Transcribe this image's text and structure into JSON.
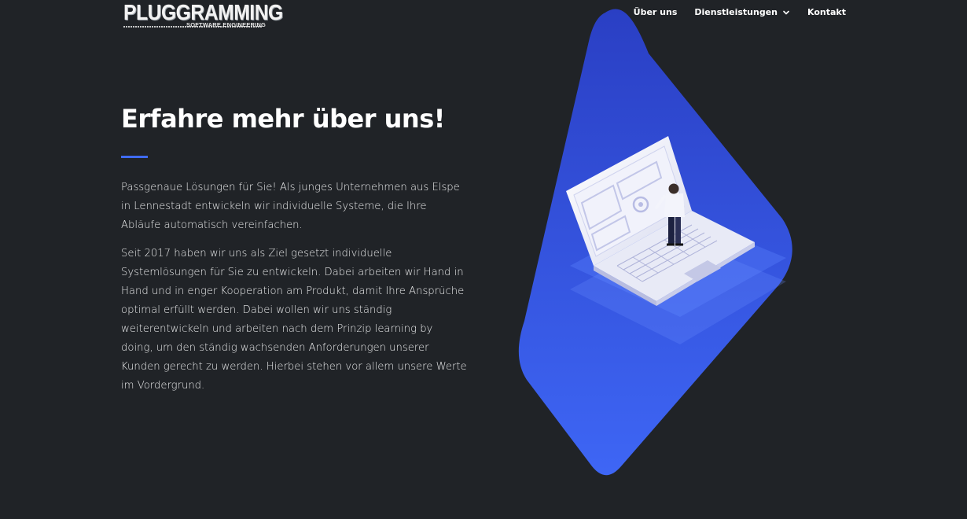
{
  "header": {
    "logo": {
      "main": "PLUGGRAMMING",
      "sub": "SOFTWARE ENGINEERING"
    },
    "nav": [
      {
        "label": "Über uns"
      },
      {
        "label": "Dienstleistungen",
        "icon": "chevron-down-icon"
      },
      {
        "label": "Kontakt"
      }
    ]
  },
  "main": {
    "heading": "Erfahre mehr über uns!",
    "accent_color": "#3f6bf2",
    "paragraphs": [
      "Passgenaue Lösungen für Sie! Als junges Unternehmen aus Elspe in Lennestadt entwickeln wir individuelle Systeme, die Ihre Abläufe automatisch vereinfachen.",
      "Seit 2017 haben wir uns als Ziel gesetzt individuelle Systemlösungen für Sie zu entwickeln. Dabei arbeiten wir Hand in Hand und in enger Kooperation am Produkt, damit Ihre Ansprüche optimal erfüllt werden. Dabei wollen wir uns ständig weiterentwickeln und arbeiten nach dem Prinzip learning by doing, um den ständig wachsenden Anforderungen unserer Kunden gerecht zu werden. Hierbei stehen vor allem unsere Werte im Vordergrund."
    ]
  },
  "illustration": {
    "icon": "laptop-developer-illustration",
    "gradient_top": "#2a3fc4",
    "gradient_bottom": "#3e66f5"
  },
  "colors": {
    "background": "#202327",
    "text": "#ffffff"
  }
}
